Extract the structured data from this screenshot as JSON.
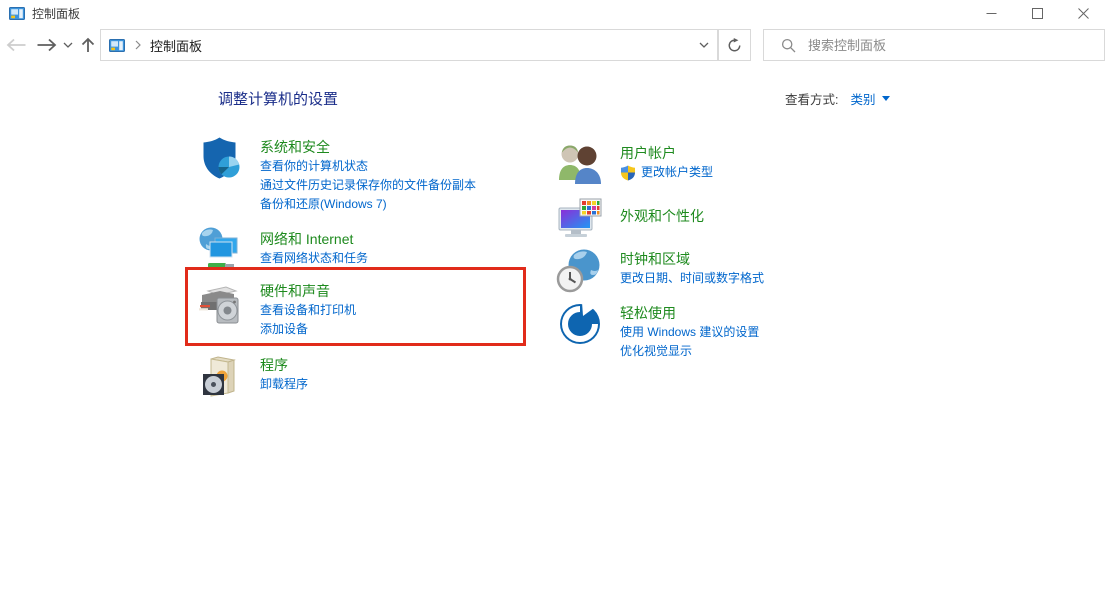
{
  "window": {
    "title": "控制面板"
  },
  "navbar": {
    "breadcrumb": "控制面板",
    "search_placeholder": "搜索控制面板"
  },
  "header": {
    "title": "调整计算机的设置",
    "view_by_label": "查看方式:",
    "view_by_value": "类别"
  },
  "categories": {
    "left": [
      {
        "id": "system-security",
        "icon": "security-shield-icon",
        "title": "系统和安全",
        "links": [
          {
            "text": "查看你的计算机状态"
          },
          {
            "text": "通过文件历史记录保存你的文件备份副本"
          },
          {
            "text": "备份和还原(Windows 7)"
          }
        ]
      },
      {
        "id": "network-internet",
        "icon": "network-icon",
        "title": "网络和 Internet",
        "links": [
          {
            "text": "查看网络状态和任务"
          }
        ]
      },
      {
        "id": "hardware-sound",
        "icon": "hardware-sound-icon",
        "title": "硬件和声音",
        "highlighted": true,
        "links": [
          {
            "text": "查看设备和打印机"
          },
          {
            "text": "添加设备"
          }
        ]
      },
      {
        "id": "programs",
        "icon": "programs-icon",
        "title": "程序",
        "links": [
          {
            "text": "卸载程序"
          }
        ]
      }
    ],
    "right": [
      {
        "id": "user-accounts",
        "icon": "user-accounts-icon",
        "title": "用户帐户",
        "links": [
          {
            "text": "更改帐户类型",
            "shield": true
          }
        ]
      },
      {
        "id": "appearance-personalization",
        "icon": "appearance-icon",
        "title": "外观和个性化",
        "links": []
      },
      {
        "id": "clock-region",
        "icon": "clock-region-icon",
        "title": "时钟和区域",
        "links": [
          {
            "text": "更改日期、时间或数字格式"
          }
        ]
      },
      {
        "id": "ease-of-access",
        "icon": "ease-of-access-icon",
        "title": "轻松使用",
        "links": [
          {
            "text": "使用 Windows 建议的设置"
          },
          {
            "text": "优化视觉显示"
          }
        ]
      }
    ]
  },
  "colors": {
    "category_title": "#1e8a1e",
    "link": "#0066cc",
    "heading": "#1b2e8a",
    "highlight_box": "#e12b1a"
  }
}
